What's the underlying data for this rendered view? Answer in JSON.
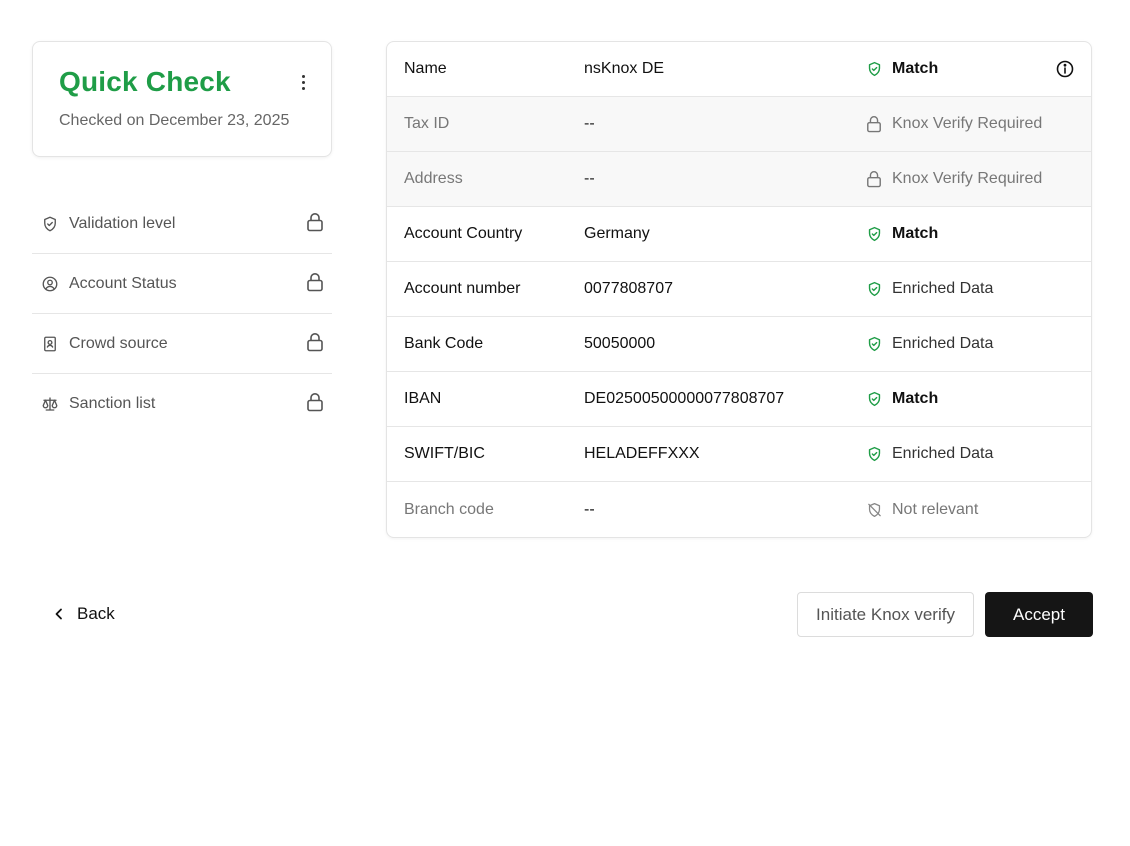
{
  "colors": {
    "accent_green": "#1f9d47",
    "primary_button": "#151515",
    "muted_row_bg": "#f8f8f8"
  },
  "summary_card": {
    "title": "Quick Check",
    "subtitle": "Checked on December 23, 2025",
    "menu_icon": "kebab-menu-icon"
  },
  "sidebar": {
    "items": [
      {
        "label": "Validation level",
        "icon": "shield-check-icon",
        "locked": true
      },
      {
        "label": "Account Status",
        "icon": "user-circle-icon",
        "locked": true
      },
      {
        "label": "Crowd source",
        "icon": "contact-book-icon",
        "locked": true
      },
      {
        "label": "Sanction list",
        "icon": "scale-icon",
        "locked": true
      }
    ]
  },
  "table": {
    "rows": [
      {
        "field": "Name",
        "value": "nsKnox DE",
        "status": "Match",
        "status_icon": "shield-check-icon"
      },
      {
        "field": "Tax ID",
        "value": "--",
        "status": "Knox Verify Required",
        "status_icon": "lock-icon"
      },
      {
        "field": "Address",
        "value": "--",
        "status": "Knox Verify Required",
        "status_icon": "lock-icon"
      },
      {
        "field": "Account Country",
        "value": "Germany",
        "status": "Match",
        "status_icon": "shield-check-icon"
      },
      {
        "field": "Account number",
        "value": "0077808707",
        "status": "Enriched Data",
        "status_icon": "shield-check-icon"
      },
      {
        "field": "Bank Code",
        "value": "50050000",
        "status": "Enriched Data",
        "status_icon": "shield-check-icon"
      },
      {
        "field": "IBAN",
        "value": "DE02500500000077808707",
        "status": "Match",
        "status_icon": "shield-check-icon"
      },
      {
        "field": "SWIFT/BIC",
        "value": "HELADEFFXXX",
        "status": "Enriched Data",
        "status_icon": "shield-check-icon"
      },
      {
        "field": "Branch code",
        "value": "--",
        "status": "Not relevant",
        "status_icon": "shield-off-icon"
      }
    ]
  },
  "actions": {
    "back_label": "Back",
    "secondary_label": "Initiate Knox verify",
    "primary_label": "Accept"
  }
}
